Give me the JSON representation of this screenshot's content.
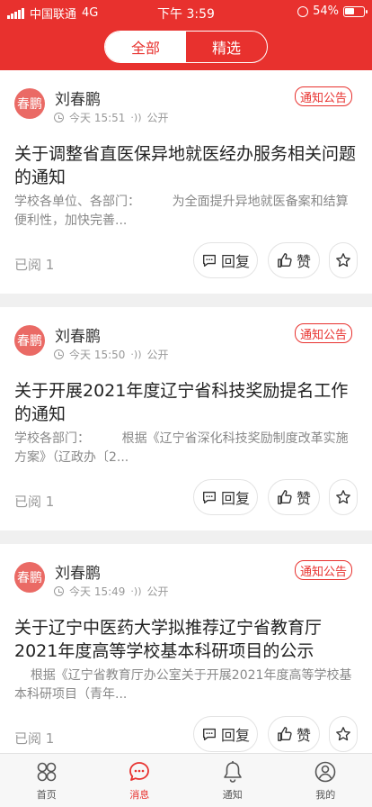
{
  "status_bar": {
    "carrier": "中国联通",
    "network": "4G",
    "time": "下午 3:59",
    "battery_percent": "54%",
    "battery_level": 0.54
  },
  "segmented": {
    "tabs": [
      {
        "label": "全部",
        "active": true
      },
      {
        "label": "精选",
        "active": false
      }
    ]
  },
  "cards": [
    {
      "avatar_text": "春鹏",
      "author": "刘春鹏",
      "time": "今天 15:51",
      "visibility": "公开",
      "badge": "通知公告",
      "title": "关于调整省直医保异地就医经办服务相关问题的通知",
      "excerpt": "学校各单位、各部门：        为全面提升异地就医备案和结算便利性，加快完善...",
      "read": "已阅 1",
      "reply_label": "回复",
      "like_label": "赞"
    },
    {
      "avatar_text": "春鹏",
      "author": "刘春鹏",
      "time": "今天 15:50",
      "visibility": "公开",
      "badge": "通知公告",
      "title": "关于开展2021年度辽宁省科技奖励提名工作的通知",
      "excerpt": "学校各部门：        根据《辽宁省深化科技奖励制度改革实施方案》（辽政办〔2...",
      "read": "已阅 1",
      "reply_label": "回复",
      "like_label": "赞"
    },
    {
      "avatar_text": "春鹏",
      "author": "刘春鹏",
      "time": "今天 15:49",
      "visibility": "公开",
      "badge": "通知公告",
      "title": "关于辽宁中医药大学拟推荐辽宁省教育厅2021年度高等学校基本科研项目的公示",
      "excerpt": "    根据《辽宁省教育厅办公室关于开展2021年度高等学校基本科研项目（青年...",
      "read": "已阅 1",
      "reply_label": "回复",
      "like_label": "赞"
    }
  ],
  "tabbar": {
    "items": [
      {
        "label": "首页",
        "icon": "home-grid-icon",
        "active": false
      },
      {
        "label": "消息",
        "icon": "message-bubble-icon",
        "active": true
      },
      {
        "label": "通知",
        "icon": "bell-icon",
        "active": false
      },
      {
        "label": "我的",
        "icon": "user-icon",
        "active": false
      }
    ]
  }
}
